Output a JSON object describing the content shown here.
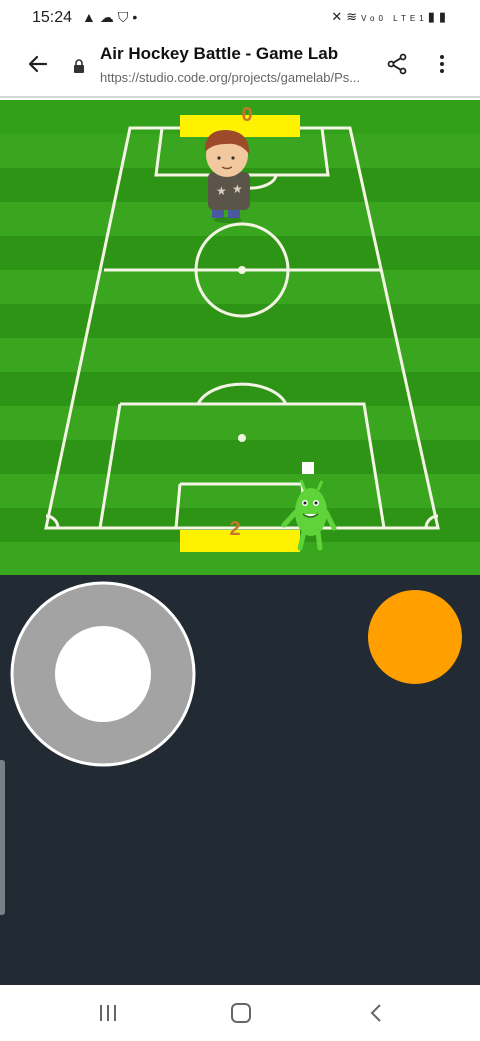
{
  "status": {
    "time": "15:24",
    "left_icons": [
      "warning-icon",
      "cloud-icon",
      "shield-icon",
      "dot-icon"
    ],
    "right_icons": [
      "mute-icon",
      "wifi-icon",
      "lte-icon",
      "signal-icon",
      "battery-icon"
    ],
    "lte_label": "Vo0 LTE1"
  },
  "browser": {
    "title": "Air Hockey Battle - Game Lab",
    "url": "https://studio.code.org/projects/gamelab/Ps..."
  },
  "game": {
    "top_score": "0",
    "bottom_score": "2",
    "colors": {
      "field_light": "#3aa61f",
      "field_dark": "#2e9416",
      "score_bar": "#fff200",
      "joystick_outer": "#a3a3a3",
      "joystick_inner": "#ffffff",
      "action_button": "#ff9f00",
      "controls_bg": "#222b34"
    }
  },
  "navbar": {
    "items": [
      "recent-apps-icon",
      "home-icon",
      "back-nav-icon"
    ]
  }
}
